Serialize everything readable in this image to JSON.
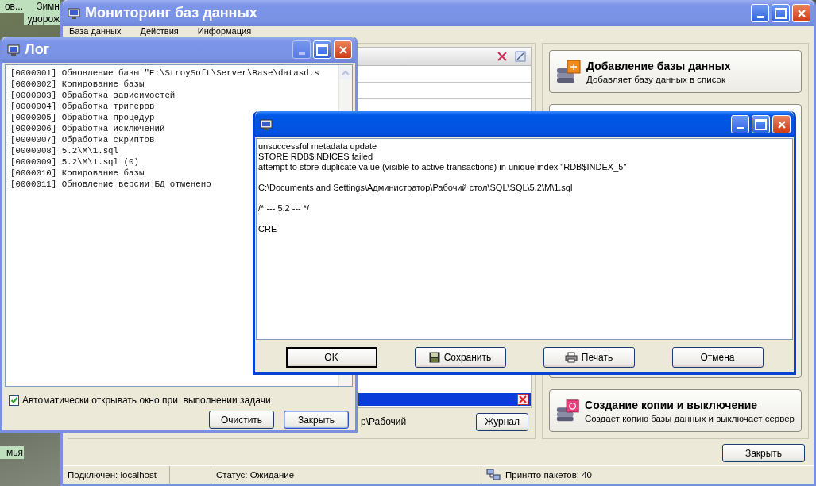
{
  "desktop": {
    "icon_labels": [
      "ов...",
      "Зимн удорож",
      "мья"
    ]
  },
  "main_window": {
    "title": "Мониторинг баз данных",
    "menu": [
      "База данных",
      "Действия",
      "Информация"
    ],
    "list": {
      "path_fragment": "р\\Рабочий",
      "journal_button": "Журнал"
    },
    "actions": [
      {
        "kind": "add",
        "title": "Добавление базы данных",
        "description": "Добавляет базу данных в список"
      },
      {
        "kind": "backup",
        "title": "Создание копии и выключение",
        "description": "Создает копию базы данных и выключает сервер"
      }
    ],
    "close_button": "Закрыть",
    "status_bar": {
      "connection": "Подключен: localhost",
      "status": "Статус: Ожидание",
      "packets": "Принято пакетов: 40"
    }
  },
  "log_window": {
    "title": "Лог",
    "minimize_disabled": true,
    "lines": [
      "[0000001] Обновление базы \"E:\\StroySoft\\Server\\Base\\datasd.s",
      "[0000002] Копирование базы",
      "[0000003] Обработка зависимостей",
      "[0000004] Обработка тригеров",
      "[0000005] Обработка процедур",
      "[0000006] Обработка исключений",
      "[0000007] Обработка скриптов",
      "[0000008] 5.2\\M\\1.sql",
      "[0000009] 5.2\\M\\1.sql (0)",
      "[0000010] Копирование базы",
      "[0000011] Обновление версии БД отменено"
    ],
    "auto_open": {
      "label": "Автоматически открывать окно при  выполнении задачи",
      "checked": true
    },
    "buttons": [
      "Очистить",
      "Закрыть"
    ]
  },
  "error_dialog": {
    "paragraphs": [
      [
        "unsuccessful metadata update",
        "STORE RDB$INDICES failed",
        "attempt to store duplicate value (visible to active transactions) in unique index \"RDB$INDEX_5\""
      ],
      [
        "C:\\Documents and Settings\\Администратор\\Рабочий стол\\SQL\\SQL\\5.2\\M\\1.sql"
      ],
      [
        "/* --- 5.2 --- */"
      ],
      [
        "CRE"
      ]
    ],
    "buttons": [
      {
        "kind": "ok",
        "label": "OK",
        "focused": true
      },
      {
        "kind": "save",
        "label": "Сохранить",
        "focused": false
      },
      {
        "kind": "print",
        "label": "Печать",
        "focused": false
      },
      {
        "kind": "cancel",
        "label": "Отмена",
        "focused": false
      }
    ]
  }
}
